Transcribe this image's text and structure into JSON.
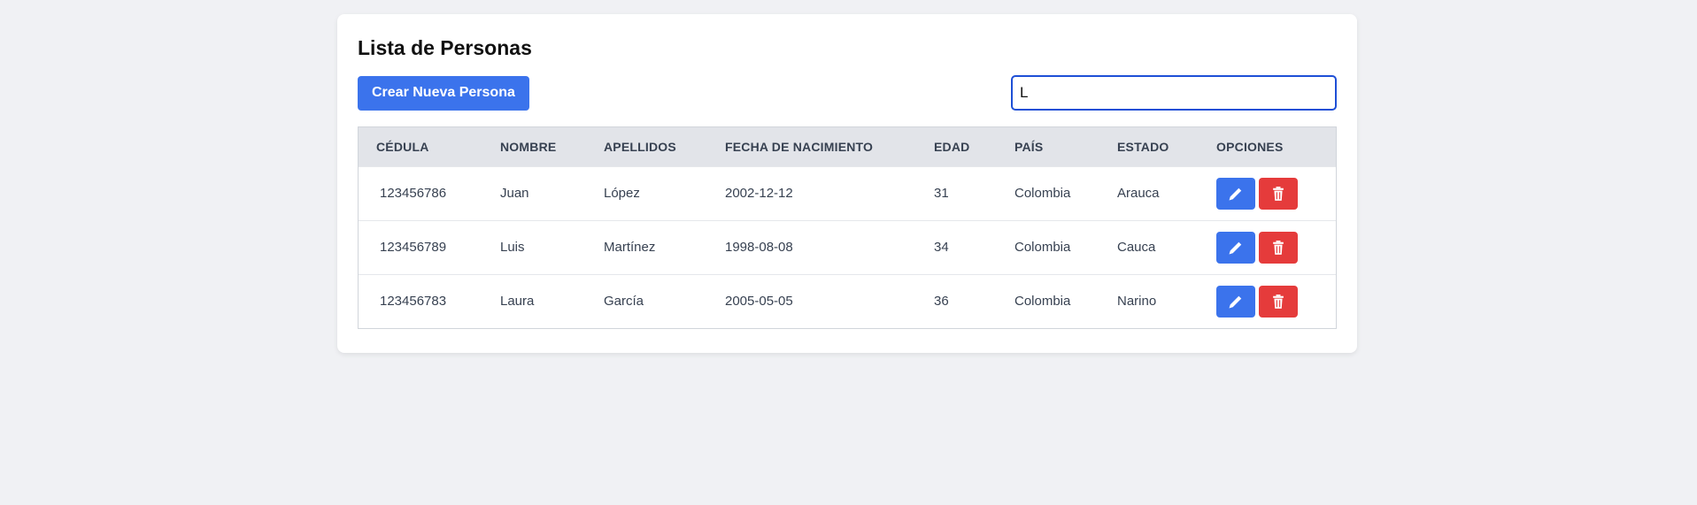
{
  "page": {
    "title": "Lista de Personas",
    "create_button_label": "Crear Nueva Persona",
    "search_value": "L"
  },
  "colors": {
    "primary": "#3b73ec",
    "danger": "#e53b3b",
    "header_bg": "#e2e4e9",
    "page_bg": "#f0f1f4"
  },
  "table": {
    "columns": [
      "CÉDULA",
      "NOMBRE",
      "APELLIDOS",
      "FECHA DE NACIMIENTO",
      "EDAD",
      "PAÍS",
      "ESTADO",
      "OPCIONES"
    ],
    "rows": [
      {
        "cedula": "123456786",
        "nombre": "Juan",
        "apellidos": "López",
        "fecha": "2002-12-12",
        "edad": "31",
        "pais": "Colombia",
        "estado": "Arauca"
      },
      {
        "cedula": "123456789",
        "nombre": "Luis",
        "apellidos": "Martínez",
        "fecha": "1998-08-08",
        "edad": "34",
        "pais": "Colombia",
        "estado": "Cauca"
      },
      {
        "cedula": "123456783",
        "nombre": "Laura",
        "apellidos": "García",
        "fecha": "2005-05-05",
        "edad": "36",
        "pais": "Colombia",
        "estado": "Narino"
      }
    ],
    "row_actions": {
      "edit_icon": "pencil-icon",
      "delete_icon": "trash-icon"
    }
  }
}
